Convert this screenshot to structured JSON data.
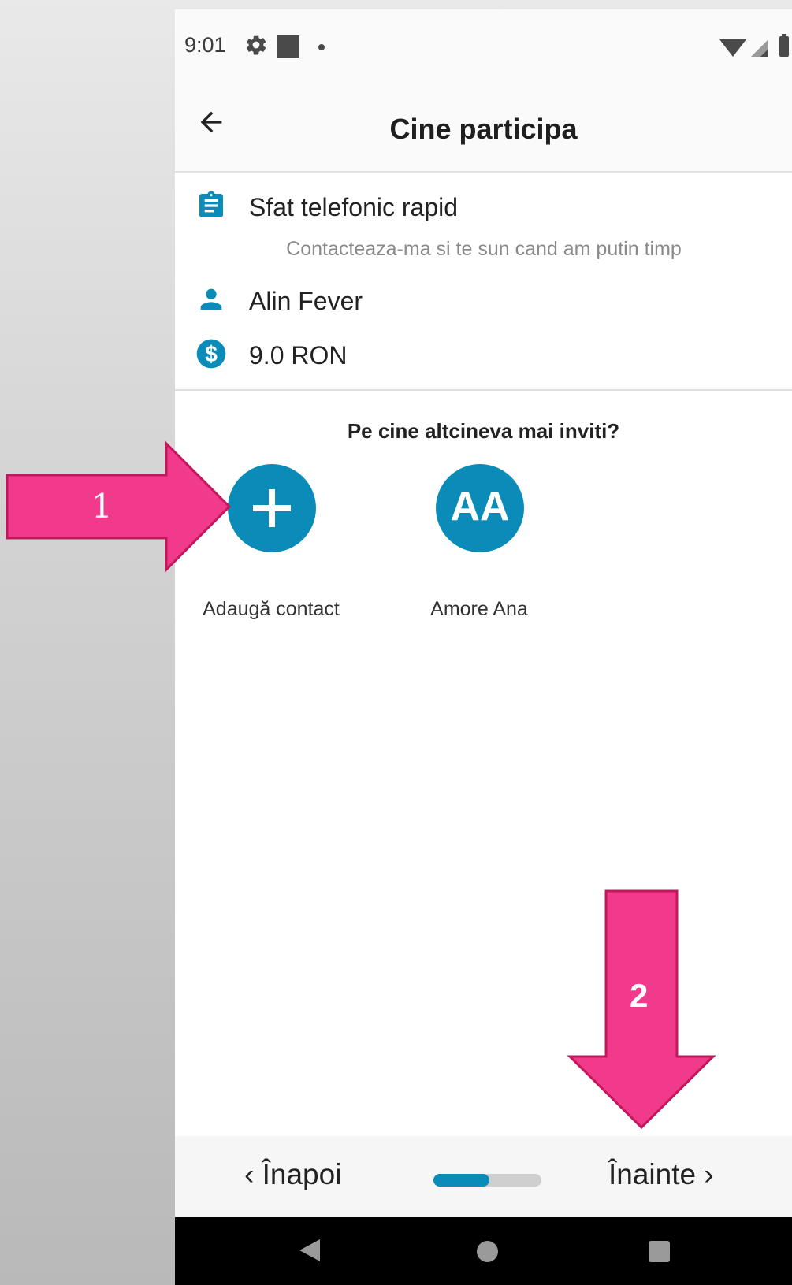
{
  "status_bar": {
    "time": "9:01"
  },
  "app_bar": {
    "title": "Cine participa"
  },
  "service": {
    "name": "Sfat telefonic rapid",
    "description": "Contacteaza-ma si te sun cand am putin timp",
    "expert": "Alin Fever",
    "price": "9.0 RON"
  },
  "invite": {
    "title": "Pe cine altcineva mai inviti?",
    "contacts": [
      {
        "label": "Adaugă contact",
        "icon": "plus-icon"
      },
      {
        "label": "Amore Ana",
        "initials": "AA"
      }
    ]
  },
  "bottom_nav": {
    "back_label": "Înapoi",
    "next_label": "Înainte",
    "progress": 0.52
  },
  "callouts": [
    {
      "number": "1"
    },
    {
      "number": "2"
    }
  ],
  "colors": {
    "accent": "#0b8cb8",
    "callout": "#f23a8c",
    "callout_border": "#c2185b"
  }
}
